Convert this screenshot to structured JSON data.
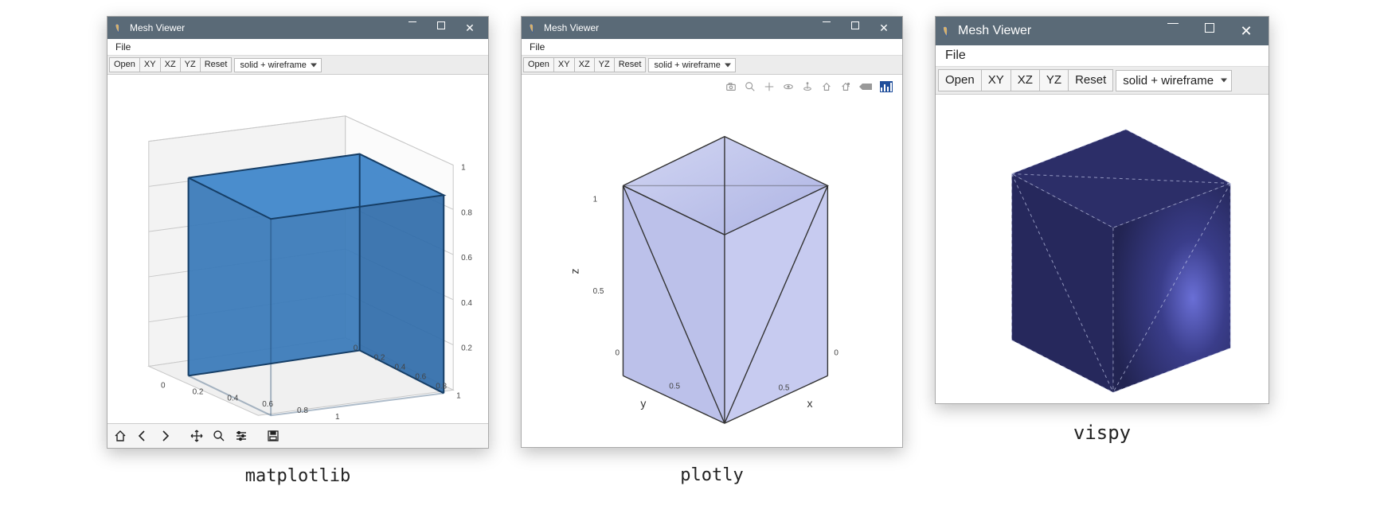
{
  "windows": [
    {
      "key": "matplotlib",
      "title": "Mesh Viewer",
      "menu": {
        "file": "File"
      },
      "toolbar": {
        "open": "Open",
        "xy": "XY",
        "xz": "XZ",
        "yz": "YZ",
        "reset": "Reset",
        "mode": "solid + wireframe"
      },
      "chart_data": {
        "type": "3d-mesh",
        "shape": "cube",
        "face_color": "#3778b9",
        "edge_color": "#163e66",
        "wireframe": true,
        "axes": {
          "x": {
            "ticks": [
              0.0,
              0.2,
              0.4,
              0.6,
              0.8,
              1.0
            ],
            "range": [
              0.0,
              1.0
            ]
          },
          "y": {
            "ticks": [
              0.0,
              0.2,
              0.4,
              0.6,
              0.8,
              1.0
            ],
            "range": [
              0.0,
              1.0
            ]
          },
          "z": {
            "ticks": [
              0.2,
              0.4,
              0.6,
              0.8,
              1.0
            ],
            "range": [
              0.0,
              1.0
            ]
          }
        }
      },
      "mpl_icons": [
        "home-icon",
        "back-icon",
        "forward-icon",
        "sep",
        "pan-icon",
        "zoom-icon",
        "configure-icon",
        "sep",
        "save-icon"
      ],
      "label": "matplotlib"
    },
    {
      "key": "plotly",
      "title": "Mesh Viewer",
      "menu": {
        "file": "File"
      },
      "toolbar": {
        "open": "Open",
        "xy": "XY",
        "xz": "XZ",
        "yz": "YZ",
        "reset": "Reset",
        "mode": "solid + wireframe"
      },
      "chart_data": {
        "type": "3d-mesh",
        "shape": "cube-triangulated",
        "face_color": "#c1c5ec",
        "edge_color": "#333333",
        "wireframe": true,
        "axes": {
          "x": {
            "label": "x",
            "ticks": [
              0,
              0.5
            ],
            "range": [
              0,
              1
            ]
          },
          "y": {
            "label": "y",
            "ticks": [
              0,
              0.5
            ],
            "range": [
              0,
              1
            ]
          },
          "z": {
            "label": "z",
            "ticks": [
              0.5,
              1
            ],
            "range": [
              0,
              1
            ]
          }
        }
      },
      "modebar_icons": [
        "camera-icon",
        "zoom-icon",
        "pan-icon",
        "orbit-icon",
        "turntable-icon",
        "reset-camera-icon",
        "reset-last-icon",
        "hover-icon",
        "plotly-logo-icon"
      ],
      "label": "plotly"
    },
    {
      "key": "vispy",
      "title": "Mesh Viewer",
      "menu": {
        "file": "File"
      },
      "toolbar": {
        "open": "Open",
        "xy": "XY",
        "xz": "XZ",
        "yz": "YZ",
        "reset": "Reset",
        "mode": "solid + wireframe"
      },
      "chart_data": {
        "type": "3d-mesh",
        "shape": "cube-triangulated",
        "face_color": "#2b2d6d",
        "highlight_color": "#5a5fc0",
        "edge_color": "#9aa0c8",
        "edge_style": "dashed",
        "wireframe": true,
        "axes": null
      },
      "label": "vispy"
    }
  ]
}
